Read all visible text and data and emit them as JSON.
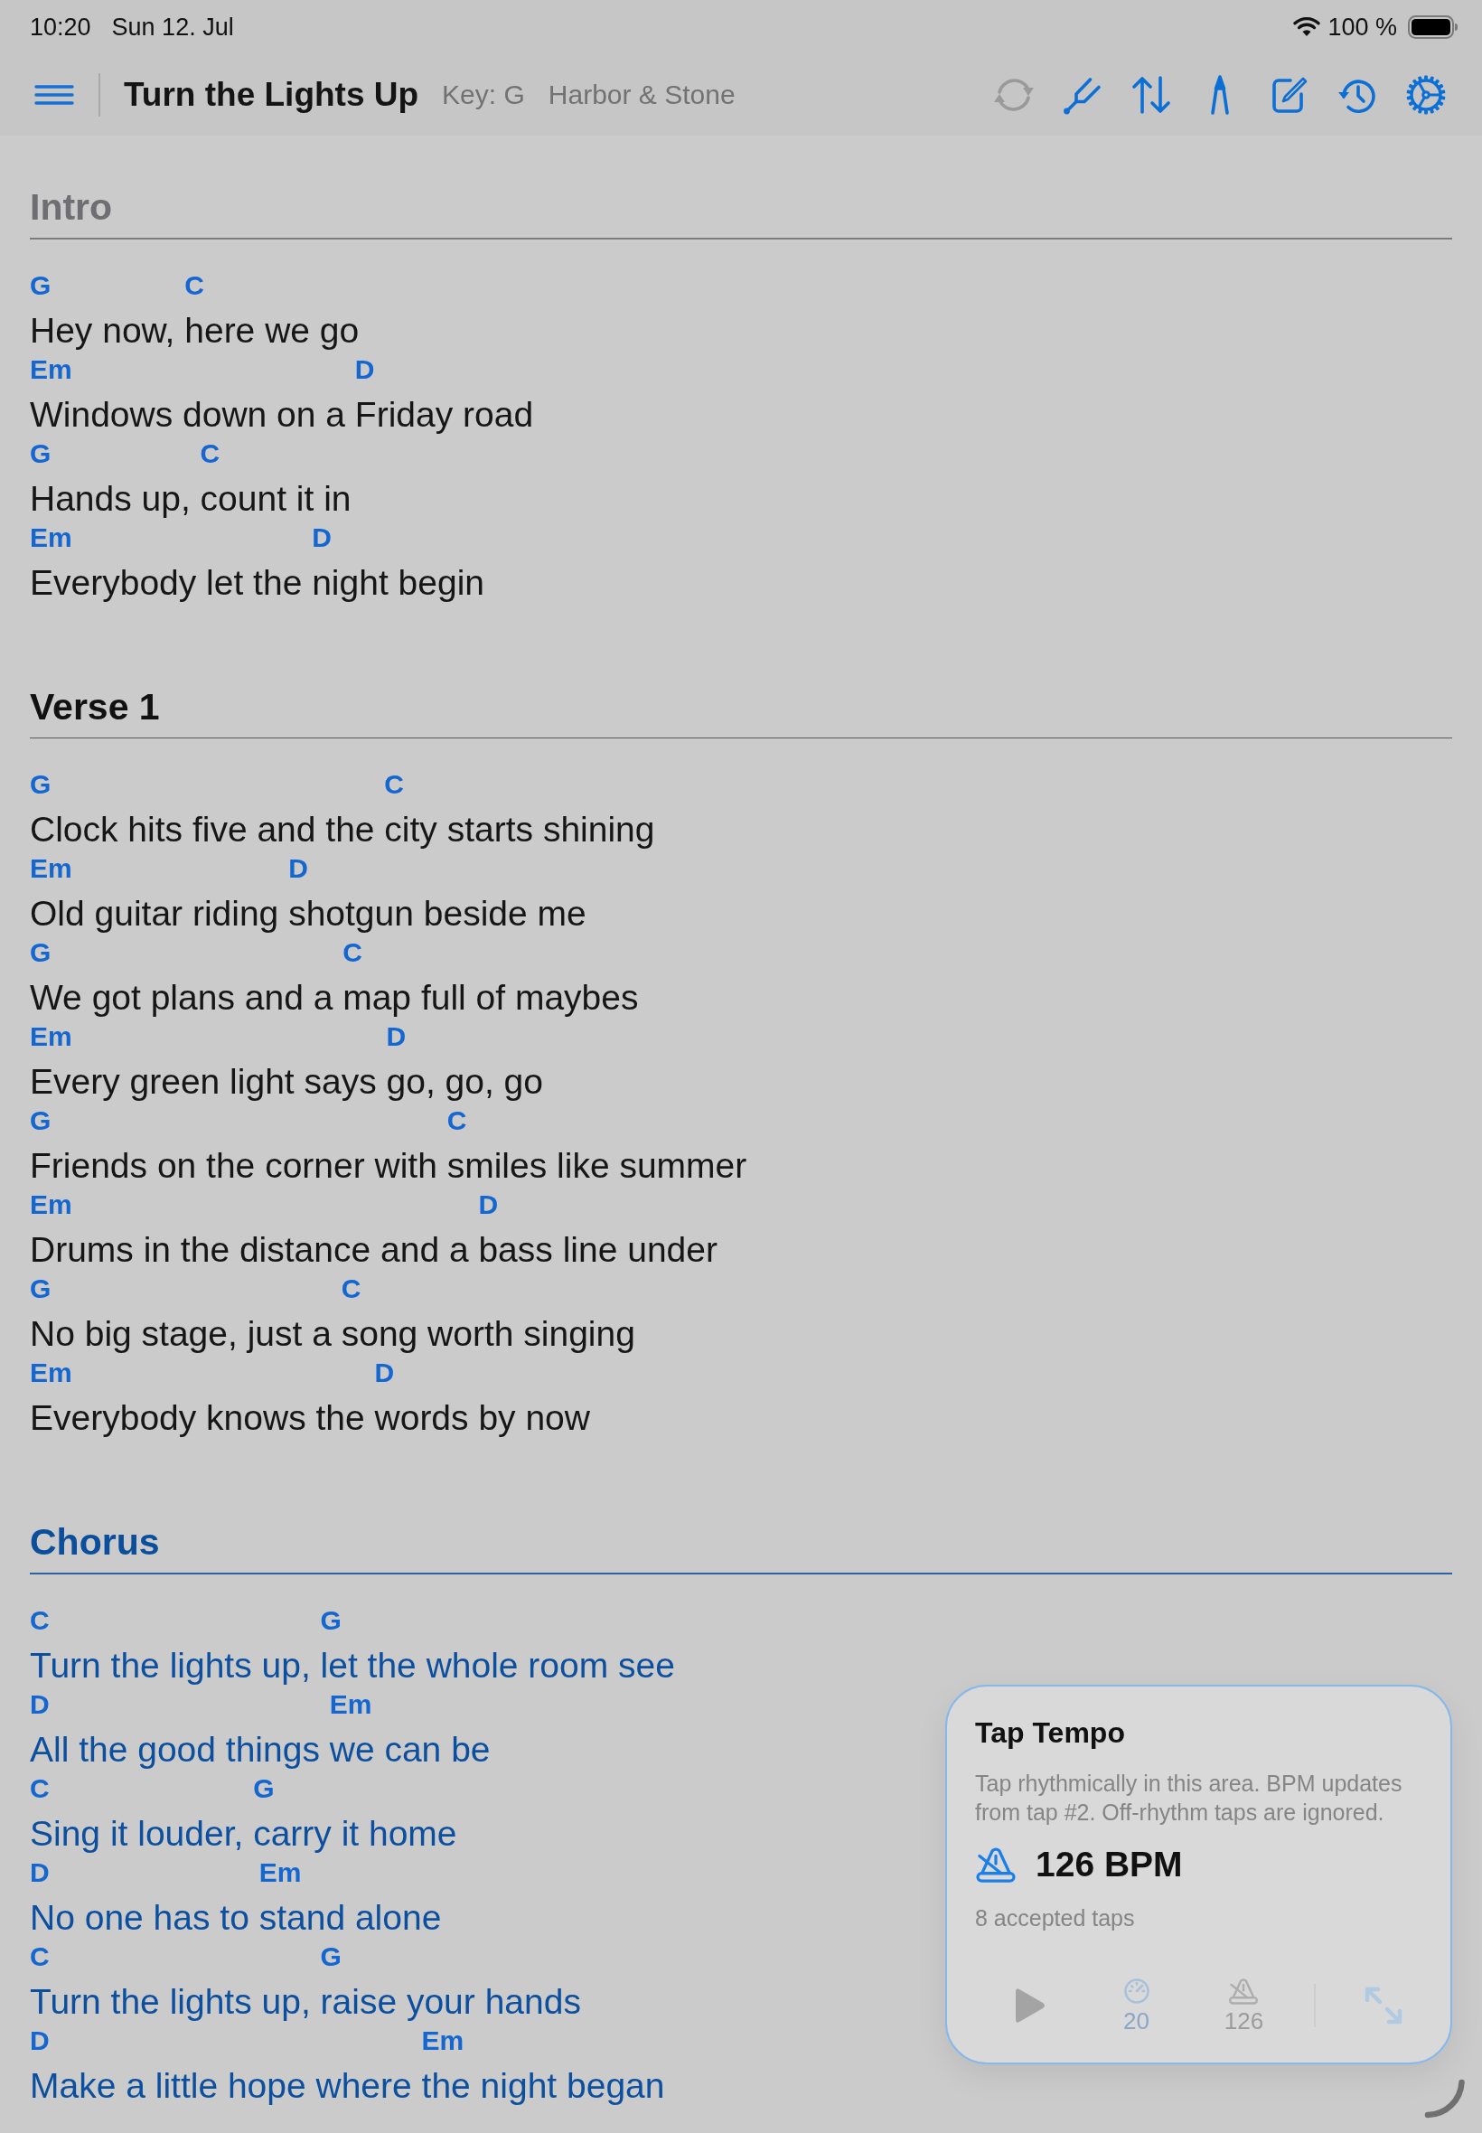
{
  "status_bar": {
    "time": "10:20",
    "date": "Sun 12. Jul",
    "battery": "100 %"
  },
  "nav": {
    "title": "Turn the Lights Up",
    "key": "Key: G",
    "artist": "Harbor & Stone",
    "toolbar": [
      {
        "kind": "sync",
        "disabled": true
      },
      {
        "kind": "tuning-fork",
        "disabled": false
      },
      {
        "kind": "transpose",
        "disabled": false
      },
      {
        "kind": "pen",
        "disabled": false
      },
      {
        "kind": "edit",
        "disabled": false
      },
      {
        "kind": "history",
        "disabled": false
      },
      {
        "kind": "settings",
        "disabled": false
      }
    ]
  },
  "sections": [
    {
      "kind": "intro",
      "title": "Intro",
      "lines": [
        {
          "segments": [
            {
              "chord": "G",
              "text": "Hey now, "
            },
            {
              "chord": "C",
              "text": "here we go"
            }
          ]
        },
        {
          "segments": [
            {
              "chord": "Em",
              "text": "Windows down on a "
            },
            {
              "chord": "D",
              "text": "Friday road"
            }
          ]
        },
        {
          "segments": [
            {
              "chord": "G",
              "text": "Hands up, "
            },
            {
              "chord": "C",
              "text": "count it in"
            }
          ]
        },
        {
          "segments": [
            {
              "chord": "Em",
              "text": "Everybody let the "
            },
            {
              "chord": "D",
              "text": "night begin"
            }
          ]
        }
      ]
    },
    {
      "kind": "verse",
      "title": "Verse 1",
      "lines": [
        {
          "segments": [
            {
              "chord": "G",
              "text": "Clock hits five and the "
            },
            {
              "chord": "C",
              "text": "city starts shining"
            }
          ]
        },
        {
          "segments": [
            {
              "chord": "Em",
              "text": "Old guitar riding "
            },
            {
              "chord": "D",
              "text": "shotgun beside me"
            }
          ]
        },
        {
          "segments": [
            {
              "chord": "G",
              "text": "We got plans and a "
            },
            {
              "chord": "C",
              "text": "map full of maybes"
            }
          ]
        },
        {
          "segments": [
            {
              "chord": "Em",
              "text": "Every green light says "
            },
            {
              "chord": "D",
              "text": "go, go, go"
            }
          ]
        },
        {
          "segments": [
            {
              "chord": "G",
              "text": "Friends on the corner with "
            },
            {
              "chord": "C",
              "text": "smiles like summer"
            }
          ]
        },
        {
          "segments": [
            {
              "chord": "Em",
              "text": "Drums in the distance and a "
            },
            {
              "chord": "D",
              "text": "bass line under"
            }
          ]
        },
        {
          "segments": [
            {
              "chord": "G",
              "text": "No big stage, just a "
            },
            {
              "chord": "C",
              "text": "song worth singing"
            }
          ]
        },
        {
          "segments": [
            {
              "chord": "Em",
              "text": "Everybody knows the "
            },
            {
              "chord": "D",
              "text": "words by now"
            }
          ]
        }
      ]
    },
    {
      "kind": "chorus",
      "title": "Chorus",
      "lines": [
        {
          "segments": [
            {
              "chord": "C",
              "text": "Turn the lights up, "
            },
            {
              "chord": "G",
              "text": "let the whole room see"
            }
          ]
        },
        {
          "segments": [
            {
              "chord": "D",
              "text": "All the good things "
            },
            {
              "chord": "Em",
              "text": "we can be"
            }
          ]
        },
        {
          "segments": [
            {
              "chord": "C",
              "text": "Sing it louder, "
            },
            {
              "chord": "G",
              "text": "carry it home"
            }
          ]
        },
        {
          "segments": [
            {
              "chord": "D",
              "text": "No one has to "
            },
            {
              "chord": "Em",
              "text": "stand alone"
            }
          ]
        },
        {
          "segments": [
            {
              "chord": "C",
              "text": "Turn the lights up, "
            },
            {
              "chord": "G",
              "text": "raise your hands"
            }
          ]
        },
        {
          "segments": [
            {
              "chord": "D",
              "text": "Make a little hope where "
            },
            {
              "chord": "Em",
              "text": "the night began"
            }
          ]
        }
      ]
    }
  ],
  "tap_tempo": {
    "title": "Tap Tempo",
    "description": "Tap rhythmically in this area. BPM updates from tap #2. Off-rhythm taps are ignored.",
    "bpm": "126 BPM",
    "accepted": "8 accepted taps",
    "toolbar": [
      {
        "kind": "play"
      },
      {
        "kind": "speed",
        "label": "20"
      },
      {
        "kind": "metronome",
        "label": "126"
      },
      {
        "kind": "expand"
      }
    ]
  }
}
